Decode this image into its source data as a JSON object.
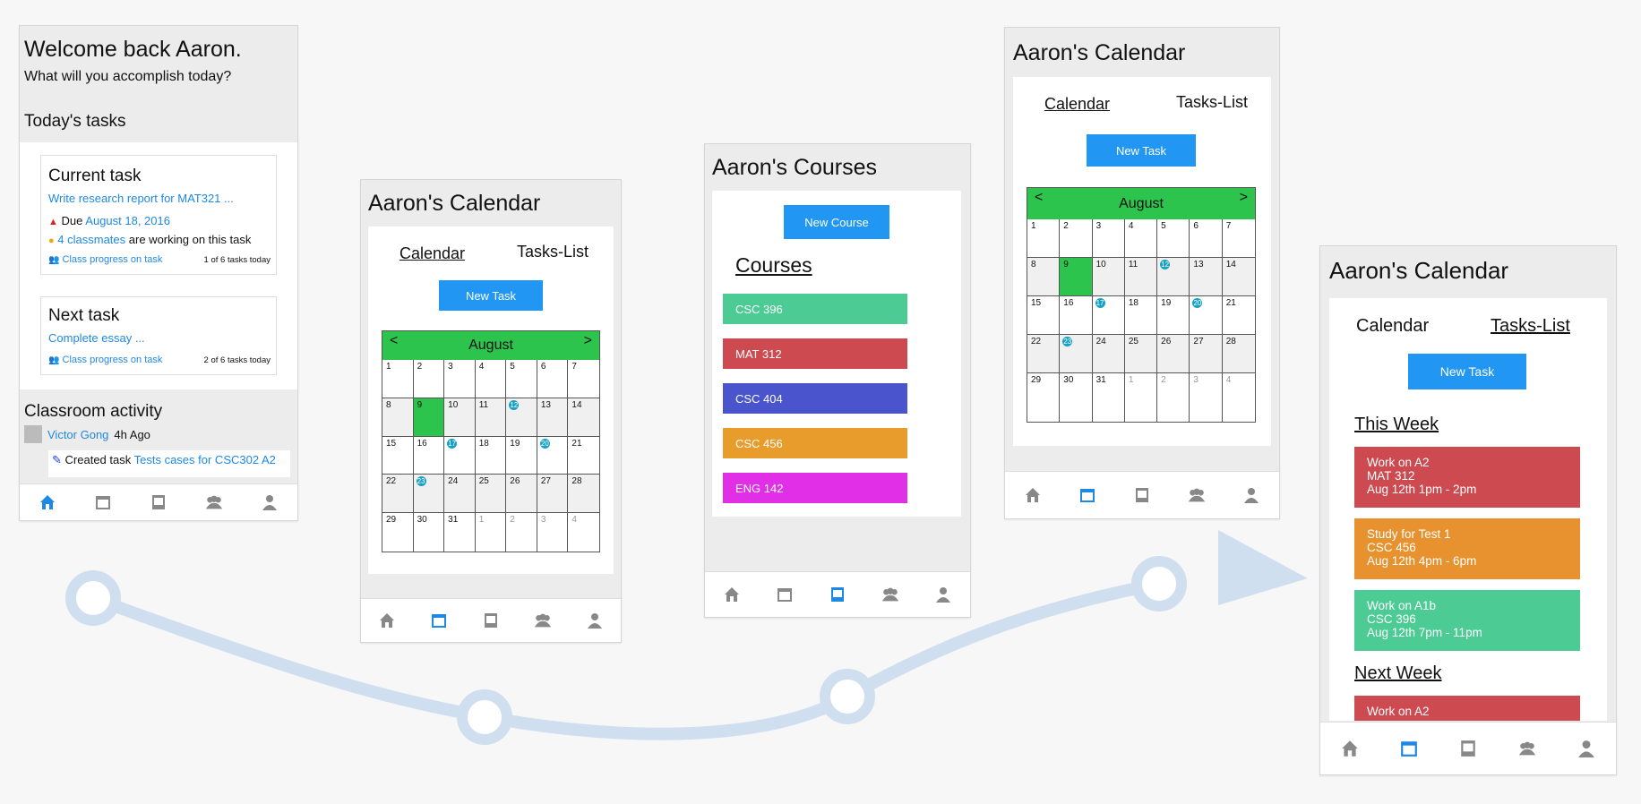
{
  "colors": {
    "accent": "#2196f3",
    "green": "#2cc44c",
    "red": "#cc4a50",
    "orange": "#e8922f",
    "teal": "#4ccb94",
    "blue": "#4a55cd",
    "magenta": "#e02fe6",
    "amber": "#e89c2c"
  },
  "nav_icons": [
    "home-icon",
    "calendar-icon",
    "book-icon",
    "group-icon",
    "user-icon"
  ],
  "home": {
    "title": "Welcome back Aaron.",
    "subtitle": "What will you accomplish today?",
    "todays_tasks": "Today's tasks",
    "current": {
      "label": "Current task",
      "link": "Write research report for MAT321 ...",
      "due_prefix": "Due",
      "due_date": "August 18, 2016",
      "classmates": "4 classmates",
      "classmates_suffix": "are working on this task",
      "progress_link": "Class progress on task",
      "progress_count": "1 of 6 tasks today"
    },
    "next": {
      "label": "Next task",
      "link": "Complete essay ...",
      "progress_link": "Class progress on task",
      "progress_count": "2 of 6 tasks today"
    },
    "activity": {
      "title": "Classroom activity",
      "user": "Victor Gong",
      "time": "4h Ago",
      "action": "Created task",
      "task_link": "Tests cases for CSC302 A2"
    }
  },
  "calendar": {
    "title": "Aaron's Calendar",
    "tab_calendar": "Calendar",
    "tab_tasks": "Tasks-List",
    "new_task": "New Task",
    "month": "August",
    "prev": "<",
    "next": ">",
    "days": [
      {
        "d": "1",
        "s": ""
      },
      {
        "d": "2",
        "s": ""
      },
      {
        "d": "3",
        "s": ""
      },
      {
        "d": "4",
        "s": ""
      },
      {
        "d": "5",
        "s": ""
      },
      {
        "d": "6",
        "s": ""
      },
      {
        "d": "7",
        "s": ""
      },
      {
        "d": "8",
        "s": "shade"
      },
      {
        "d": "9",
        "s": "sel"
      },
      {
        "d": "10",
        "s": "shade"
      },
      {
        "d": "11",
        "s": "shade"
      },
      {
        "d": "12",
        "s": "dot"
      },
      {
        "d": "13",
        "s": "shade"
      },
      {
        "d": "14",
        "s": "shade"
      },
      {
        "d": "15",
        "s": ""
      },
      {
        "d": "16",
        "s": ""
      },
      {
        "d": "17",
        "s": "dot"
      },
      {
        "d": "18",
        "s": ""
      },
      {
        "d": "19",
        "s": ""
      },
      {
        "d": "20",
        "s": "dot"
      },
      {
        "d": "21",
        "s": ""
      },
      {
        "d": "22",
        "s": "shade"
      },
      {
        "d": "23",
        "s": "dot"
      },
      {
        "d": "24",
        "s": "shade"
      },
      {
        "d": "25",
        "s": "shade"
      },
      {
        "d": "26",
        "s": "shade"
      },
      {
        "d": "27",
        "s": "shade"
      },
      {
        "d": "28",
        "s": "shade"
      },
      {
        "d": "29",
        "s": ""
      },
      {
        "d": "30",
        "s": ""
      },
      {
        "d": "31",
        "s": ""
      },
      {
        "d": "1",
        "s": "dim"
      },
      {
        "d": "2",
        "s": "dim"
      },
      {
        "d": "3",
        "s": "dim"
      },
      {
        "d": "4",
        "s": "dim"
      }
    ]
  },
  "courses": {
    "title": "Aaron's Courses",
    "new_course": "New Course",
    "heading": "Courses",
    "items": [
      {
        "name": "CSC 396",
        "color": "#4ccb94"
      },
      {
        "name": "MAT 312",
        "color": "#cc4a50"
      },
      {
        "name": "CSC 404",
        "color": "#4a55cd"
      },
      {
        "name": "CSC 456",
        "color": "#e89c2c"
      },
      {
        "name": "ENG 142",
        "color": "#e02fe6"
      }
    ]
  },
  "tasks_list": {
    "title": "Aaron's Calendar",
    "tab_calendar": "Calendar",
    "tab_tasks": "Tasks-List",
    "new_task": "New Task",
    "this_week": "This Week",
    "next_week": "Next Week",
    "week_tasks": [
      {
        "line1": "Work on A2",
        "line2": "MAT 312",
        "line3": "Aug 12th 1pm - 2pm",
        "color": "#cc4a50"
      },
      {
        "line1": "Study for Test 1",
        "line2": "CSC 456",
        "line3": "Aug 12th 4pm - 6pm",
        "color": "#e8922f"
      },
      {
        "line1": "Work on A1b",
        "line2": "CSC 396",
        "line3": "Aug 12th 7pm - 11pm",
        "color": "#4ccb94"
      }
    ],
    "next_tasks": [
      {
        "line1": "Work on A2",
        "color": "#cc4a50"
      }
    ]
  }
}
